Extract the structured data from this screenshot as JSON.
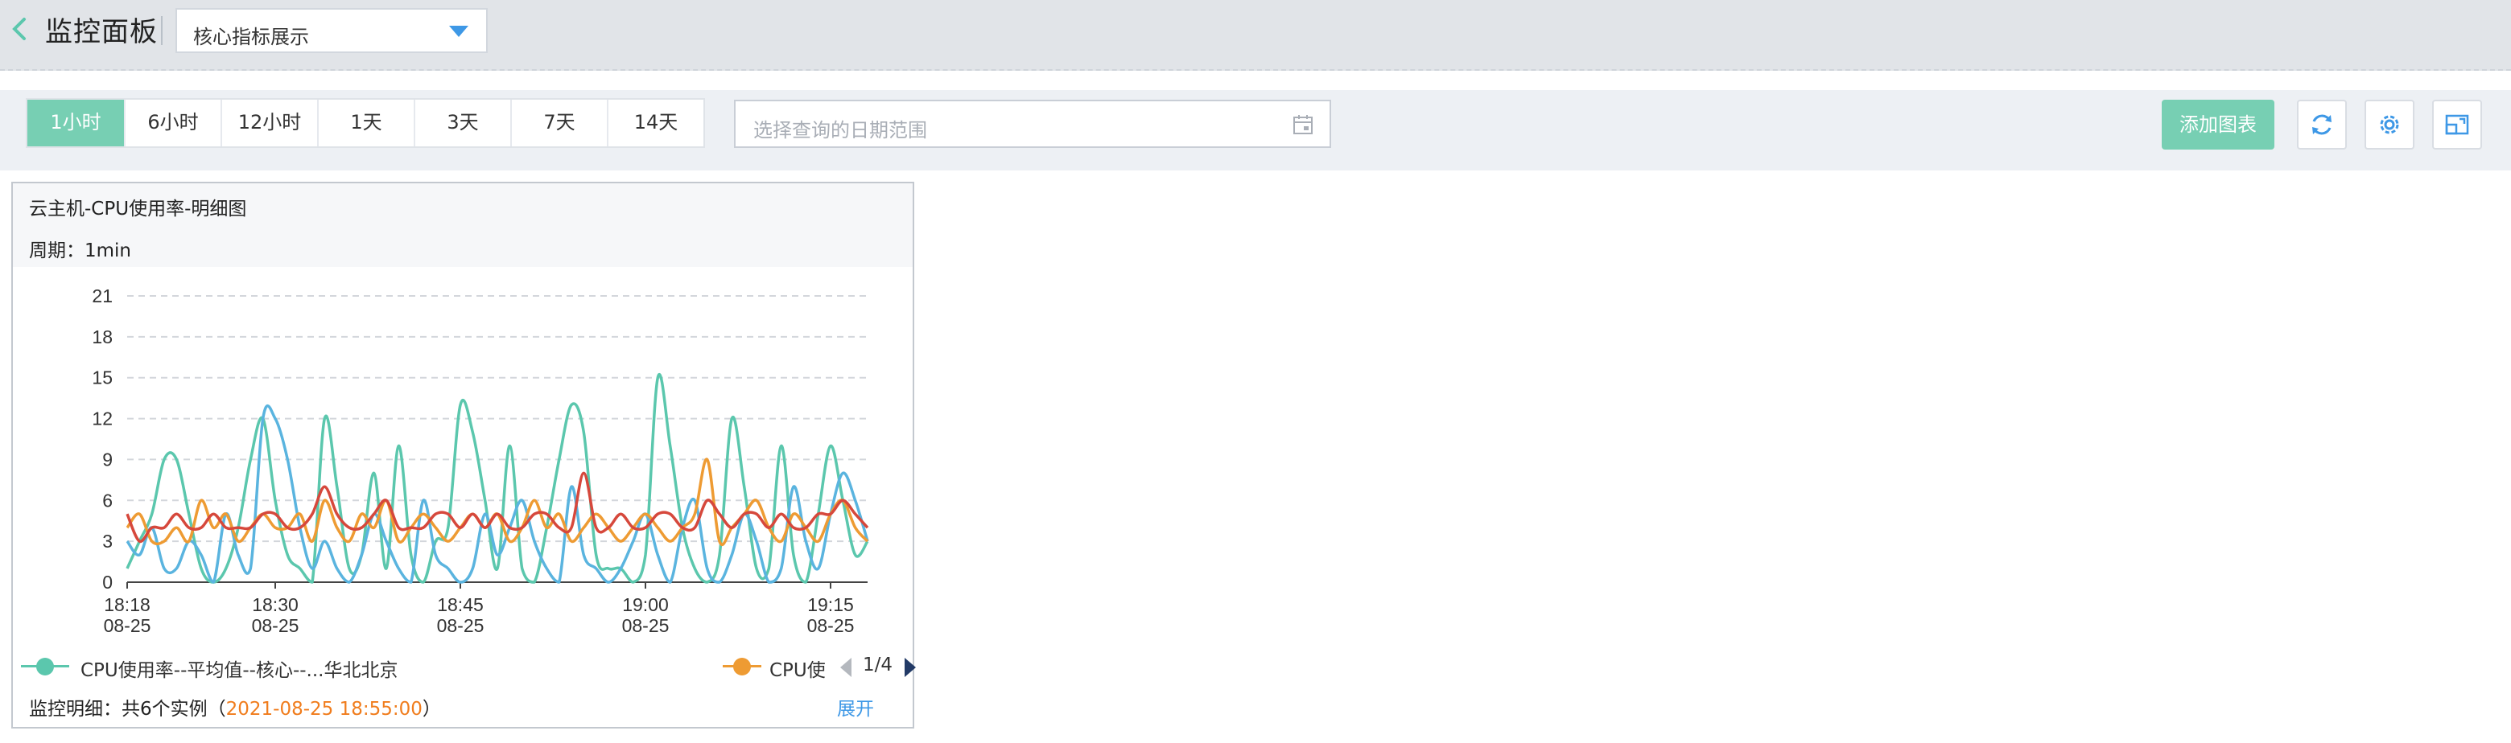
{
  "header": {
    "title": "监控面板",
    "dashboard_select": "核心指标展示"
  },
  "toolbar": {
    "ranges": [
      "1小时",
      "6小时",
      "12小时",
      "1天",
      "3天",
      "7天",
      "14天"
    ],
    "active_range": "1小时",
    "date_placeholder": "选择查询的日期范围",
    "add_chart_label": "添加图表",
    "accent_color": "#77cfb3"
  },
  "card": {
    "title": "云主机-CPU使用率-明细图",
    "period": "周期：1min",
    "legend": {
      "item1": "CPU使用率--平均值--核心--...华北北京",
      "item2": "CPU使",
      "page": "1/4"
    },
    "footer": {
      "prefix": "监控明细：共6个实例（",
      "timestamp": "2021-08-25 18:55:00",
      "suffix": "）",
      "expand": "展开"
    }
  },
  "chart_data": {
    "type": "line",
    "title": "",
    "ylim": [
      0,
      21
    ],
    "yticks": [
      0,
      3,
      6,
      9,
      12,
      15,
      18,
      21
    ],
    "xlim": [
      0,
      60
    ],
    "xticks": [
      {
        "x": 0,
        "time": "18:18",
        "date": "08-25"
      },
      {
        "x": 12,
        "time": "18:30",
        "date": "08-25"
      },
      {
        "x": 27,
        "time": "18:45",
        "date": "08-25"
      },
      {
        "x": 42,
        "time": "19:00",
        "date": "08-25"
      },
      {
        "x": 57,
        "time": "19:15",
        "date": "08-25"
      }
    ],
    "grid": true,
    "series": [
      {
        "color": "#5bc7ad",
        "values": [
          1,
          3,
          5,
          9,
          9,
          5,
          1,
          0,
          1,
          4,
          9,
          12,
          6,
          2,
          1,
          0,
          12,
          7,
          1,
          2,
          8,
          1,
          10,
          2,
          0,
          3,
          4,
          13,
          11,
          6,
          1,
          10,
          1,
          0,
          4,
          9,
          13,
          11,
          2,
          1,
          1,
          0,
          2,
          15,
          10,
          4,
          1,
          0,
          2,
          12,
          7,
          1,
          1,
          10,
          2,
          0,
          5,
          10,
          6,
          2,
          3
        ]
      },
      {
        "color": "#5ab4df",
        "values": [
          3,
          2,
          4,
          1,
          1,
          3,
          2,
          0,
          5,
          2,
          1,
          12,
          12,
          9,
          4,
          1,
          3,
          1,
          0,
          2,
          5,
          3,
          1,
          0,
          6,
          2,
          1,
          0,
          1,
          5,
          2,
          4,
          6,
          3,
          1,
          0,
          7,
          2,
          1,
          0,
          1,
          3,
          5,
          2,
          0,
          4,
          6,
          1,
          0,
          2,
          5,
          3,
          0,
          1,
          7,
          3,
          1,
          5,
          8,
          6,
          3
        ]
      },
      {
        "color": "#ee9b33",
        "values": [
          4,
          5,
          3,
          3,
          4,
          3,
          6,
          4,
          5,
          3,
          4,
          5,
          4,
          4,
          5,
          3,
          6,
          4,
          3,
          5,
          4,
          6,
          3,
          4,
          5,
          4,
          3,
          4,
          5,
          4,
          5,
          3,
          4,
          6,
          4,
          5,
          3,
          4,
          5,
          4,
          3,
          4,
          5,
          4,
          3,
          4,
          5,
          9,
          3,
          4,
          5,
          6,
          4,
          3,
          5,
          4,
          3,
          5,
          6,
          4,
          3
        ]
      },
      {
        "color": "#d6483c",
        "values": [
          5,
          3,
          4,
          4,
          5,
          4,
          4,
          5,
          4,
          4,
          4,
          5,
          5,
          4,
          4,
          5,
          7,
          5,
          4,
          4,
          5,
          6,
          4,
          4,
          4,
          5,
          5,
          4,
          5,
          4,
          5,
          4,
          4,
          5,
          5,
          4,
          4,
          8,
          4,
          4,
          5,
          4,
          4,
          5,
          5,
          4,
          4,
          6,
          5,
          4,
          5,
          5,
          4,
          5,
          4,
          4,
          5,
          5,
          6,
          5,
          4
        ]
      }
    ]
  }
}
